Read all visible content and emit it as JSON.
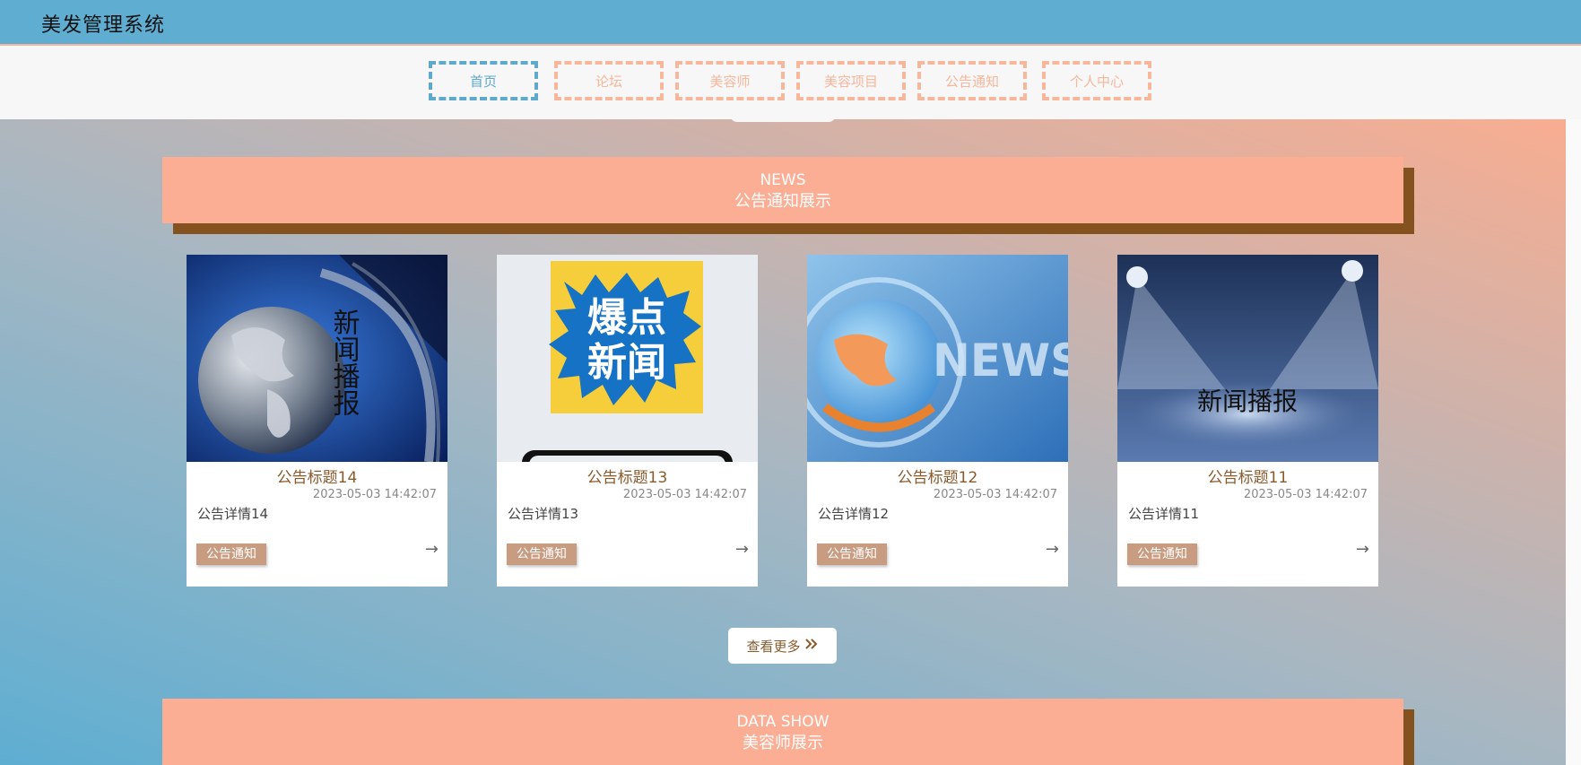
{
  "app": {
    "title": "美发管理系统"
  },
  "nav": {
    "items": [
      {
        "label": "首页",
        "active": true
      },
      {
        "label": "论坛",
        "active": false
      },
      {
        "label": "美容师",
        "active": false
      },
      {
        "label": "美容项目",
        "active": false
      },
      {
        "label": "公告通知",
        "active": false
      },
      {
        "label": "个人中心",
        "active": false
      }
    ]
  },
  "news_section": {
    "en": "NEWS",
    "cn": "公告通知展示"
  },
  "cards": [
    {
      "title": "公告标题14",
      "time": "2023-05-03 14:42:07",
      "detail": "公告详情14",
      "tag": "公告通知",
      "arrow": "→",
      "image_text": "新闻播报"
    },
    {
      "title": "公告标题13",
      "time": "2023-05-03 14:42:07",
      "detail": "公告详情13",
      "tag": "公告通知",
      "arrow": "→",
      "image_text_line1": "爆点",
      "image_text_line2": "新闻"
    },
    {
      "title": "公告标题12",
      "time": "2023-05-03 14:42:07",
      "detail": "公告详情12",
      "tag": "公告通知",
      "arrow": "→",
      "image_text": "NEWS"
    },
    {
      "title": "公告标题11",
      "time": "2023-05-03 14:42:07",
      "detail": "公告详情11",
      "tag": "公告通知",
      "arrow": "→",
      "image_text": "新闻播报"
    }
  ],
  "more_button": {
    "label": "查看更多",
    "icon": "double-chevron-right-icon"
  },
  "data_section": {
    "en": "DATA SHOW",
    "cn": "美容师展示"
  },
  "colors": {
    "header_blue": "#5fadd0",
    "accent_peach": "#fcae94",
    "banner_shadow": "#84521f",
    "title_brown": "#8b5a2b",
    "tag_tan": "#c79c80"
  }
}
